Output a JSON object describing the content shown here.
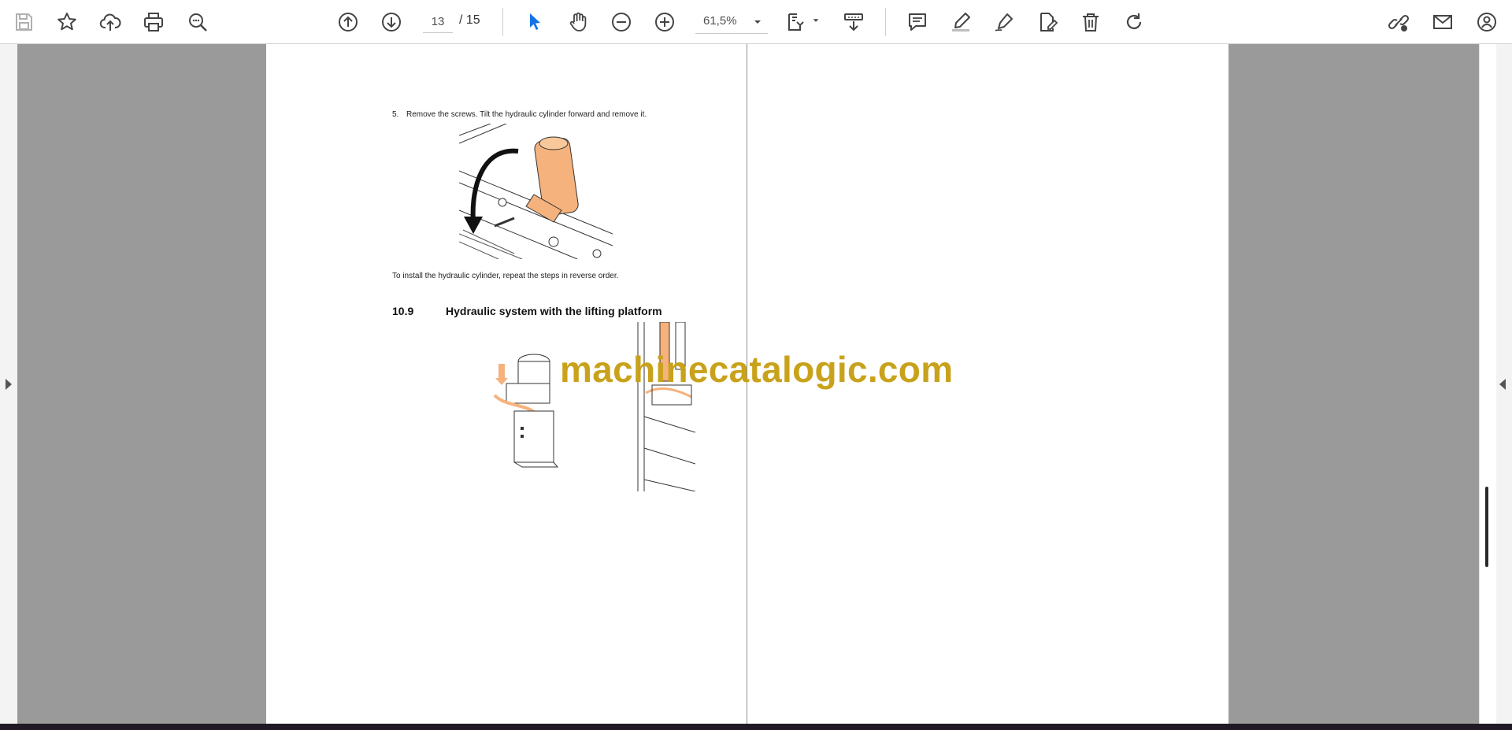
{
  "toolbar": {
    "page_current": "13",
    "page_total": "/ 15",
    "zoom": "61,5%",
    "icons": {
      "save": "save-icon",
      "bookmark": "star-icon",
      "upload": "cloud-upload-icon",
      "print": "printer-icon",
      "find": "search-icon",
      "prev_page": "arrow-up-circle-icon",
      "next_page": "arrow-down-circle-icon",
      "select": "cursor-icon",
      "hand": "hand-icon",
      "zoom_out": "minus-circle-icon",
      "zoom_in": "plus-circle-icon",
      "fit": "fit-page-icon",
      "read_mode": "read-mode-icon",
      "comment": "comment-icon",
      "highlight": "highlighter-icon",
      "draw": "pen-icon",
      "fill_sign": "fill-sign-icon",
      "delete": "trash-icon",
      "rotate": "rotate-icon",
      "share_link": "link-icon",
      "email": "envelope-icon",
      "account": "user-add-icon"
    },
    "accent_color": "#1473e6"
  },
  "document": {
    "step_number": "5.",
    "step_text": "Remove the screws. Tilt the hydraulic cylinder forward and remove it.",
    "install_text": "To install the hydraulic cylinder, repeat the steps in reverse order.",
    "section_number": "10.9",
    "section_title": "Hydraulic system with the lifting platform",
    "watermark": "machinecatalogic.com",
    "watermark_color": "#c9a21c",
    "figure_accent_color": "#f5b27c"
  }
}
